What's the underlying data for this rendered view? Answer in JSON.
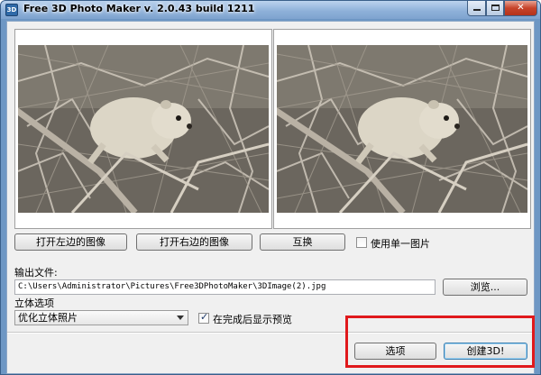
{
  "window": {
    "title": "Free 3D Photo Maker  v. 2.0.43 build 1211",
    "icon_text": "3D"
  },
  "images": {
    "left_alt": "",
    "right_alt": ""
  },
  "buttons": {
    "open_left": "打开左边的图像",
    "open_right": "打开右边的图像",
    "swap": "互换",
    "browse": "浏览...",
    "options": "选项",
    "create": "创建3D!"
  },
  "single_image": {
    "label": "使用单一图片",
    "checked": false
  },
  "output": {
    "label": "输出文件:",
    "path": "C:\\Users\\Administrator\\Pictures\\Free3DPhotoMaker\\3DImage(2).jpg"
  },
  "stereo": {
    "label": "立体选项",
    "selected": "优化立体照片"
  },
  "preview": {
    "label": "在完成后显示预览",
    "checked": true
  },
  "colors": {
    "highlight": "#e0191c",
    "titlebar": "#8fb1d9"
  }
}
